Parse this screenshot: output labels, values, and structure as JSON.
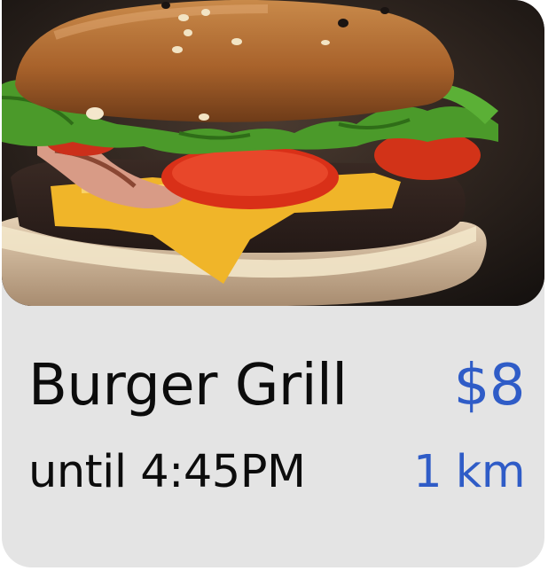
{
  "listing": {
    "image_alt": "burger-photo",
    "name": "Burger Grill",
    "price": "$8",
    "hours": "until 4:45PM",
    "distance": "1 km"
  },
  "colors": {
    "card_background": "#e4e4e4",
    "accent": "#2f5cc7",
    "text": "#0c0c0c"
  }
}
